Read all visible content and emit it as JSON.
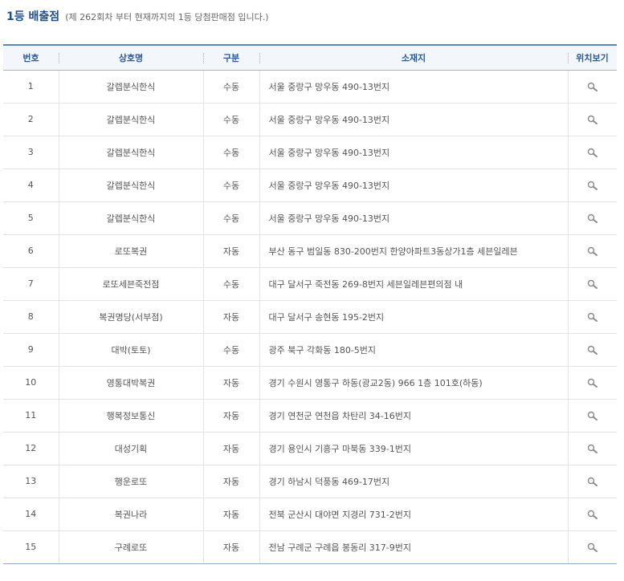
{
  "header": {
    "title": "1등 배출점",
    "note": "(제 262회차 부터 현재까지의 1등 당첨판매점 입니다.)"
  },
  "table": {
    "columns": [
      "번호",
      "상호명",
      "구분",
      "소재지",
      "위치보기"
    ],
    "rows": [
      {
        "no": "1",
        "name": "갈렙분식한식",
        "type": "수동",
        "address": "서울 중랑구 망우동 490-13번지",
        "icon": "magnifier-icon"
      },
      {
        "no": "2",
        "name": "갈렙분식한식",
        "type": "수동",
        "address": "서울 중랑구 망우동 490-13번지",
        "icon": "magnifier-icon"
      },
      {
        "no": "3",
        "name": "갈렙분식한식",
        "type": "수동",
        "address": "서울 중랑구 망우동 490-13번지",
        "icon": "magnifier-icon"
      },
      {
        "no": "4",
        "name": "갈렙분식한식",
        "type": "수동",
        "address": "서울 중랑구 망우동 490-13번지",
        "icon": "magnifier-icon"
      },
      {
        "no": "5",
        "name": "갈렙분식한식",
        "type": "수동",
        "address": "서울 중랑구 망우동 490-13번지",
        "icon": "magnifier-icon"
      },
      {
        "no": "6",
        "name": "로또복권",
        "type": "자동",
        "address": "부산 동구 범일동 830-200번지 한양아파트3동상가1층 세븐일레븐",
        "icon": "magnifier-icon"
      },
      {
        "no": "7",
        "name": "로또세븐죽전점",
        "type": "수동",
        "address": "대구 달서구 죽전동 269-8번지 세븐일레븐편의점 내",
        "icon": "magnifier-icon"
      },
      {
        "no": "8",
        "name": "복권명당(서부점)",
        "type": "자동",
        "address": "대구 달서구 송현동 195-2번지",
        "icon": "magnifier-icon"
      },
      {
        "no": "9",
        "name": "대박(토토)",
        "type": "수동",
        "address": "광주 북구 각화동 180-5번지",
        "icon": "magnifier-icon"
      },
      {
        "no": "10",
        "name": "영통대박복권",
        "type": "자동",
        "address": "경기 수원시 영통구 하동(광교2동) 966 1층 101호(하동)",
        "icon": "magnifier-icon"
      },
      {
        "no": "11",
        "name": "행복정보통신",
        "type": "자동",
        "address": "경기 연천군 연천읍 차탄리 34-16번지",
        "icon": "magnifier-icon"
      },
      {
        "no": "12",
        "name": "대성기획",
        "type": "자동",
        "address": "경기 용인시 기흥구 마북동 339-1번지",
        "icon": "magnifier-icon"
      },
      {
        "no": "13",
        "name": "행운로또",
        "type": "자동",
        "address": "경기 하남시 덕풍동 469-17번지",
        "icon": "magnifier-icon"
      },
      {
        "no": "14",
        "name": "복권나라",
        "type": "자동",
        "address": "전북 군산시 대야면 지경리 731-2번지",
        "icon": "magnifier-icon"
      },
      {
        "no": "15",
        "name": "구례로또",
        "type": "자동",
        "address": "전남 구례군 구례읍 봉동리 317-9번지",
        "icon": "magnifier-icon"
      }
    ]
  },
  "colors": {
    "title": "#1f4e8c",
    "header_text": "#2a5a9a",
    "header_line": "#5b85b9"
  }
}
